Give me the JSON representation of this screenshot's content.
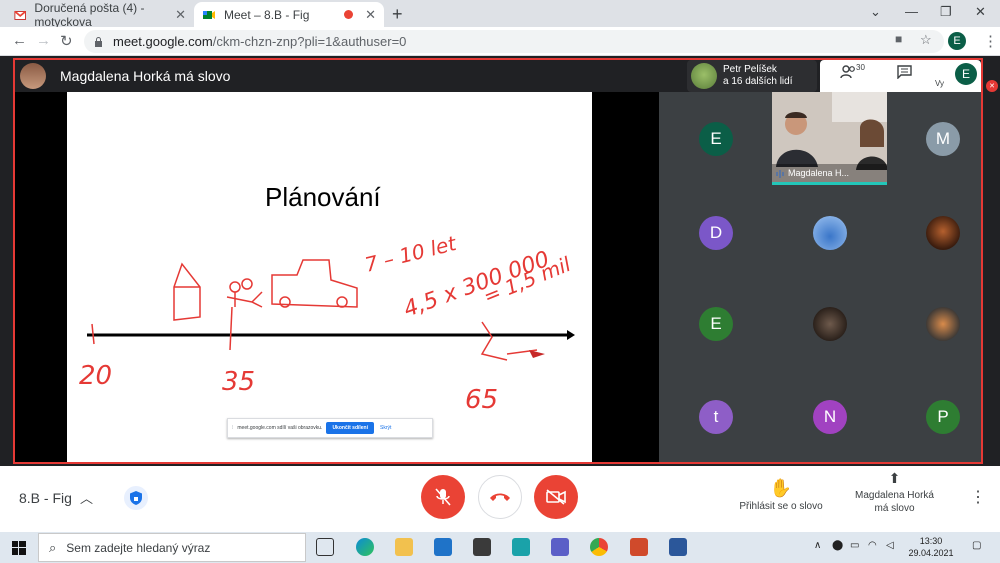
{
  "browser": {
    "tabs": [
      {
        "title": "Doručená pošta (4) - motyckova",
        "active": false
      },
      {
        "title": "Meet – 8.B - Fig",
        "active": true
      }
    ],
    "url_host": "meet.google.com",
    "url_path": "/ckm-chzn-znp?pli=1&authuser=0",
    "profile_initial": "E"
  },
  "meet": {
    "presenter_label": "Magdalena Horká má slovo",
    "joined_name": "Petr Pelíšek",
    "joined_others": "a 16 dalších lidí",
    "participant_count": "30",
    "you_label": "Vy",
    "you_initial": "E",
    "slide": {
      "title": "Plánování",
      "handwriting": {
        "age_start": "20",
        "age_mid": "35",
        "age_end": "65",
        "years": "7 – 10 let",
        "calc": "4,5 x 300 000",
        "result": "= 1,5 mil"
      },
      "share_bar": {
        "text": "meet.google.com sdílí vaši obrazovku.",
        "stop": "Ukončit sdílení",
        "hide": "Skrýt"
      }
    },
    "speaker_tile_label": "Magdalena H...",
    "tiles": [
      {
        "initial": "E",
        "color": "#0b5e47"
      },
      {
        "initial": "M",
        "color": "#8a9ba8"
      },
      {
        "initial": "D",
        "color": "#7b57c8"
      },
      {
        "initial": "E",
        "color": "#2e7d32"
      },
      {
        "initial": "t",
        "color": "#8e5ec7"
      },
      {
        "initial": "N",
        "color": "#a142c1"
      },
      {
        "initial": "P",
        "color": "#2e7d32"
      }
    ],
    "meeting_name": "8.B - Fig",
    "raise_hand_label": "Přihlásit se o slovo",
    "presenting_label": "Magdalena Horká má slovo"
  },
  "taskbar": {
    "search_placeholder": "Sem zadejte hledaný výraz",
    "time": "13:30",
    "date": "29.04.2021"
  },
  "colors": {
    "accent_red": "#ea4335",
    "outline_red": "#e53935",
    "meet_dark": "#202124",
    "speaker_accent": "#23c6b9"
  }
}
